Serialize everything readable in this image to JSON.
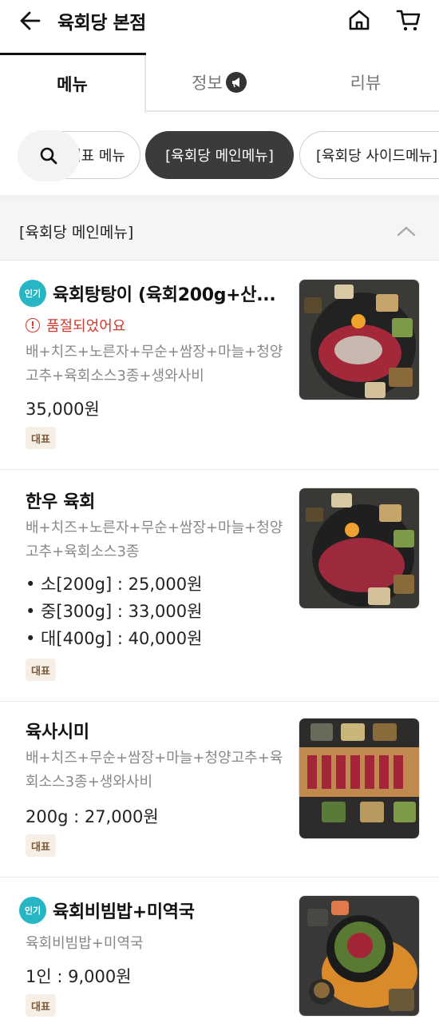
{
  "header": {
    "title": "육회당 본점",
    "back_icon": "arrow-left-icon",
    "home_icon": "home-icon",
    "cart_icon": "cart-icon"
  },
  "tabs": [
    {
      "label": "메뉴",
      "selected": true
    },
    {
      "label": "정보",
      "icon": "megaphone-icon"
    },
    {
      "label": "리뷰"
    }
  ],
  "categories": {
    "search_icon": "search-icon",
    "chips": [
      {
        "label": "대표 메뉴"
      },
      {
        "label": "[육회당 메인메뉴]",
        "selected": true
      },
      {
        "label": "[육회당 사이드메뉴]"
      }
    ]
  },
  "section": {
    "title": "[육회당 메인메뉴]"
  },
  "items": [
    {
      "badge": "인기",
      "name": "육회탕탕이 (육회200g+산...",
      "soldout": "품절되었어요",
      "desc": "배+치즈+노른자+무순+쌈장+마늘+청양고추+육회소스3종+생와사비",
      "price": "35,000원",
      "tag": "대표"
    },
    {
      "name": "한우 육회",
      "desc": "배+치즈+노른자+무순+쌈장+마늘+청양고추+육회소스3종",
      "prices": [
        "• 소[200g] : 25,000원",
        "• 중[300g] : 33,000원",
        "• 대[400g] : 40,000원"
      ],
      "tag": "대표"
    },
    {
      "name": "육사시미",
      "desc": "배+치즈+무순+쌈장+마늘+청양고추+육회소스3종+생와사비",
      "price": "200g : 27,000원",
      "tag": "대표"
    },
    {
      "badge": "인기",
      "name": "육회비빔밥+미역국",
      "desc": "육회비빔밥+미역국",
      "price": "1인 : 9,000원",
      "tag": "대표"
    }
  ],
  "colors": {
    "accent_badge": "#27b6c4",
    "soldout": "#d03b2e",
    "chip_selected_bg": "#3b3b3b",
    "tag_bg": "#f5efe6",
    "tag_text": "#7a5a3a"
  }
}
